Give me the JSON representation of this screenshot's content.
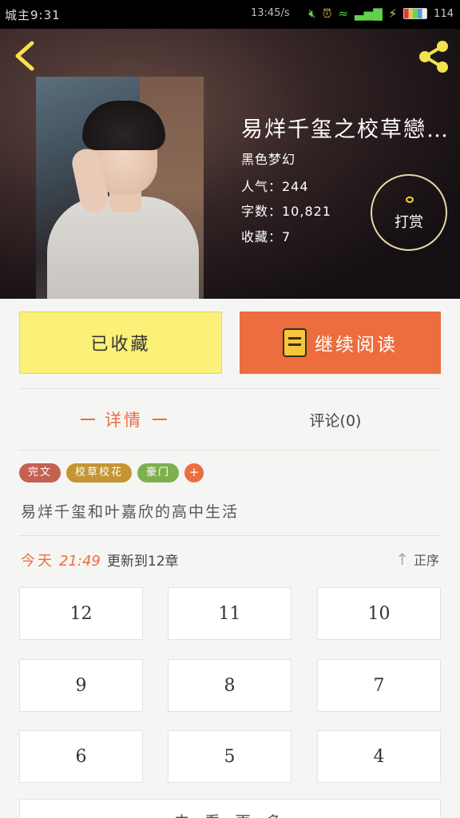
{
  "status_bar": {
    "carrier": "城主9:31",
    "time": "13:45/s",
    "battery": "114"
  },
  "header": {
    "book_title": "易烊千玺之校草戀…",
    "genre": "黑色梦幻",
    "popularity": "人气：244",
    "word_count": "字数：10,821",
    "favorites": "收藏：7",
    "tip_label": "打赏"
  },
  "actions": {
    "collected_label": "已收藏",
    "continue_label": "继续阅读"
  },
  "tabs": {
    "details": "详情",
    "comments": "评论(0)"
  },
  "tags": [
    {
      "label": "完文",
      "color": "#c46150"
    },
    {
      "label": "校草校花",
      "color": "#c49532"
    },
    {
      "label": "豪门",
      "color": "#7fb04e"
    }
  ],
  "tag_add": "+",
  "summary": "易烊千玺和叶嘉欣的高中生活",
  "update": {
    "today": "今天",
    "time": "21:49",
    "info": "更新到12章",
    "sort_label": "正序"
  },
  "chapters": [
    "12",
    "11",
    "10",
    "9",
    "8",
    "7",
    "6",
    "5",
    "4"
  ],
  "bottom_hint": "· · · 去 看 更 多 · · ·",
  "colors": {
    "accent": "#ec6d3e",
    "collected_bg": "#fbf078"
  }
}
